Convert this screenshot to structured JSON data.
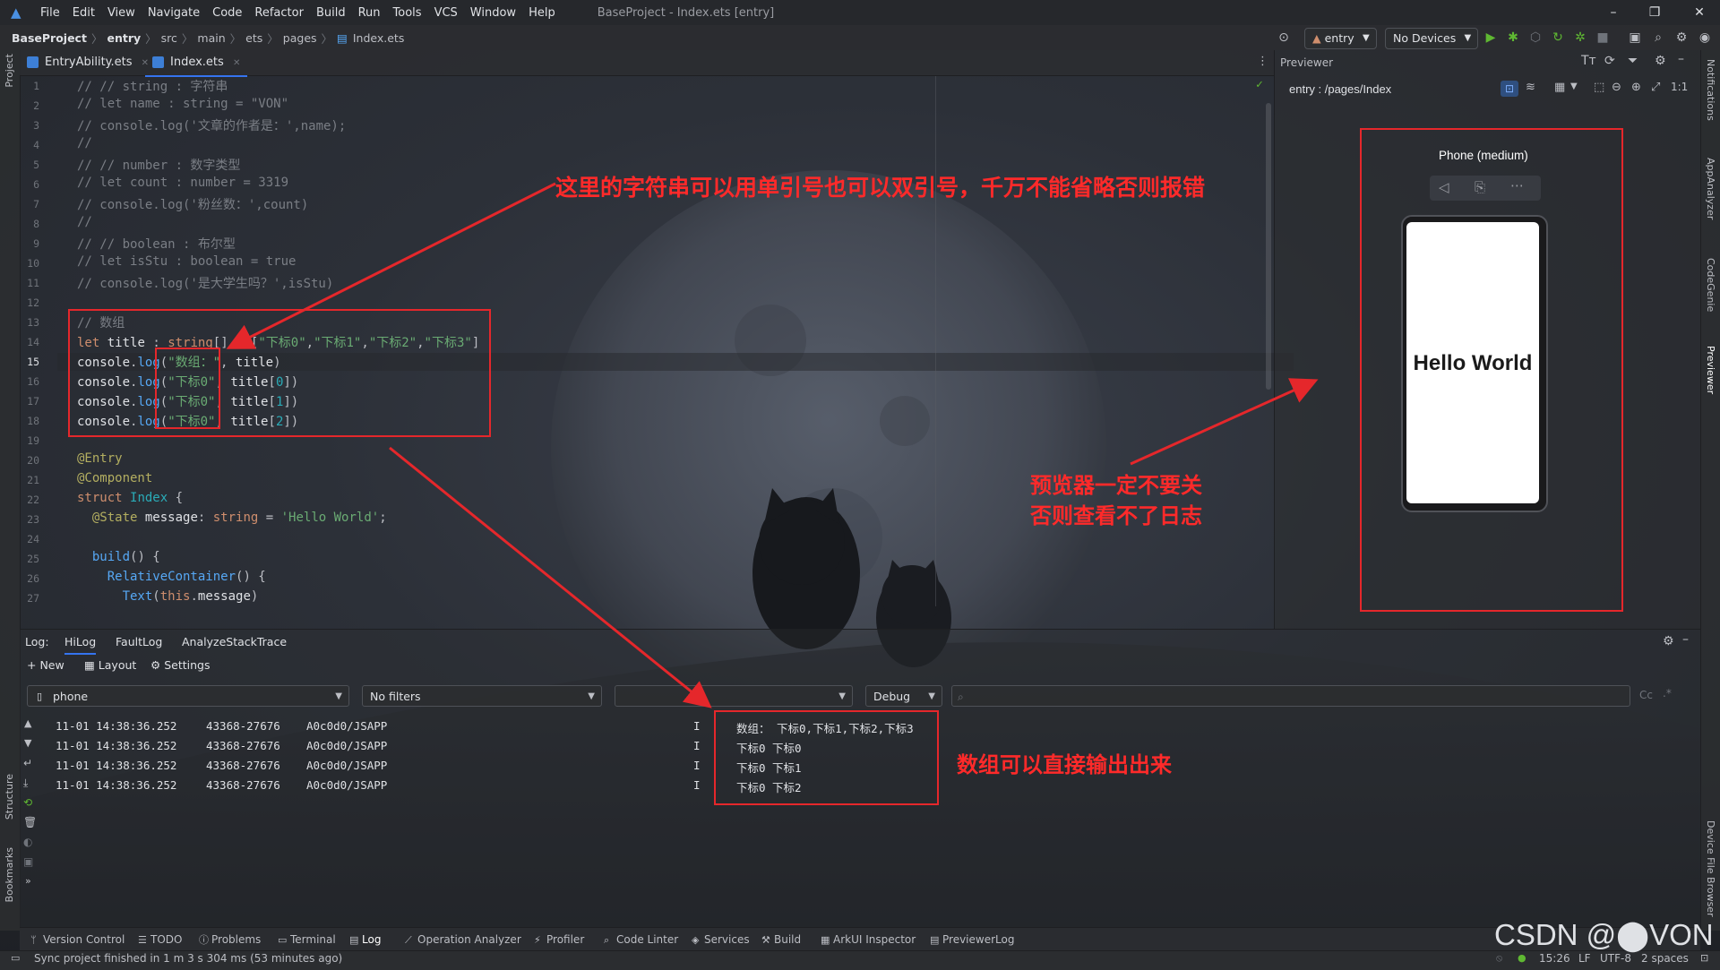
{
  "menu": {
    "items": [
      "File",
      "Edit",
      "View",
      "Navigate",
      "Code",
      "Refactor",
      "Build",
      "Run",
      "Tools",
      "VCS",
      "Window",
      "Help"
    ],
    "window_title": "BaseProject - Index.ets [entry]"
  },
  "nav": {
    "breadcrumbs": [
      "BaseProject",
      "entry",
      "src",
      "main",
      "ets",
      "pages",
      "Index.ets"
    ],
    "module_select": "entry",
    "device_select": "No Devices"
  },
  "tabs": [
    {
      "label": "EntryAbility.ets"
    },
    {
      "label": "Index.ets"
    }
  ],
  "left_strip": {
    "project": "Project",
    "structure": "Structure",
    "bookmarks": "Bookmarks"
  },
  "right_strip": {
    "notifications": "Notifications",
    "app_analyzer": "AppAnalyzer",
    "codegenie": "CodeGenie",
    "previewer": "Previewer",
    "device_file_browser": "Device File Browser"
  },
  "editor": {
    "line_numbers": [
      "1",
      "2",
      "3",
      "4",
      "5",
      "6",
      "7",
      "8",
      "9",
      "10",
      "11",
      "12",
      "13",
      "14",
      "15",
      "16",
      "17",
      "18",
      "19",
      "20",
      "21",
      "22",
      "23",
      "24",
      "25",
      "26",
      "27"
    ],
    "current_line": "15"
  },
  "previewer": {
    "title": "Previewer",
    "route": "entry : /pages/Index",
    "device_name": "Phone (medium)",
    "screen_text": "Hello World"
  },
  "log_panel": {
    "label": "Log:",
    "tabs": [
      "HiLog",
      "FaultLog",
      "AnalyzeStackTrace"
    ],
    "toolbar": {
      "new": "New",
      "layout": "Layout",
      "settings": "Settings"
    },
    "device_filter": "phone",
    "filter_select": "No filters",
    "level_select": "Debug",
    "search_placeholder": "",
    "case_toggle": "Cc",
    "rows": [
      {
        "time": "11-01 14:38:36.252",
        "pid": "43368-27676",
        "tag": "A0c0d0/JSAPP",
        "level": "I",
        "message": "数组： 下标0,下标1,下标2,下标3"
      },
      {
        "time": "11-01 14:38:36.252",
        "pid": "43368-27676",
        "tag": "A0c0d0/JSAPP",
        "level": "I",
        "message": "下标0 下标0"
      },
      {
        "time": "11-01 14:38:36.252",
        "pid": "43368-27676",
        "tag": "A0c0d0/JSAPP",
        "level": "I",
        "message": "下标0 下标1"
      },
      {
        "time": "11-01 14:38:36.252",
        "pid": "43368-27676",
        "tag": "A0c0d0/JSAPP",
        "level": "I",
        "message": "下标0 下标2"
      }
    ]
  },
  "bottom_tools": [
    "Version Control",
    "TODO",
    "Problems",
    "Terminal",
    "Log",
    "Operation Analyzer",
    "Profiler",
    "Code Linter",
    "Services",
    "Build",
    "ArkUI Inspector",
    "PreviewerLog"
  ],
  "status": {
    "message": "Sync project finished in 1 m 3 s 304 ms (53 minutes ago)",
    "time": "15:26",
    "line_sep": "LF",
    "encoding": "UTF-8",
    "indent": "2 spaces"
  },
  "annotations": {
    "string_note": "这里的字符串可以用单引号也可以双引号，千万不能省略否则报错",
    "previewer_note_1": "预览器一定不要关",
    "previewer_note_2": "否则查看不了日志",
    "array_note": "数组可以直接输出出来"
  },
  "watermark": "CSDN @⬤VON",
  "colors": {
    "annotation": "#e5272b",
    "accent": "#3574f0",
    "run": "#5fb832"
  }
}
